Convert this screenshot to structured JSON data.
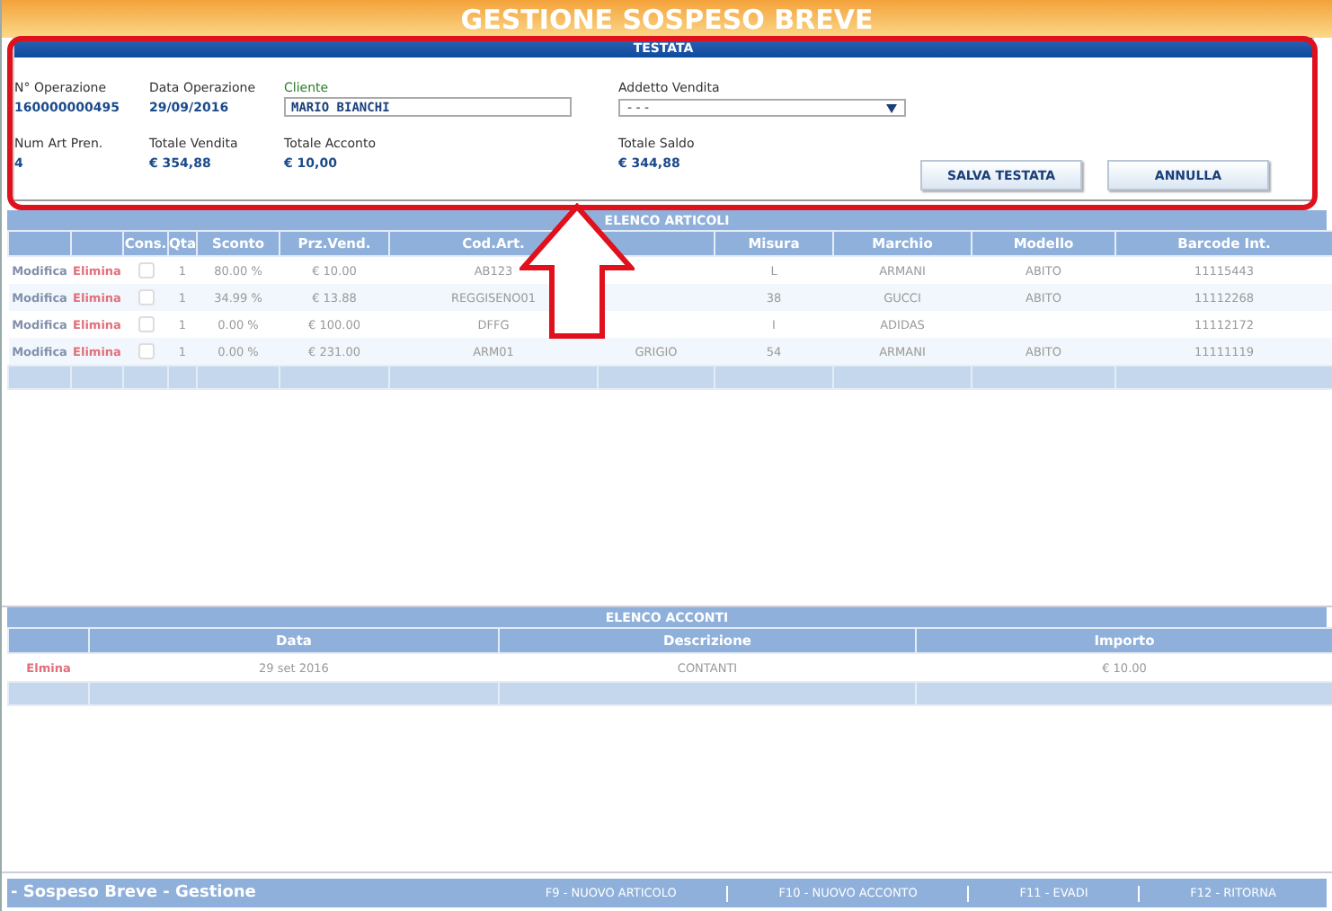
{
  "window": {
    "title": "GESTIONE SOSPESO BREVE"
  },
  "testata": {
    "title": "TESTATA",
    "fields": [
      {
        "label": "N° Operazione",
        "value": "160000000495"
      },
      {
        "label": "Data Operazione",
        "value": "29/09/2016"
      },
      {
        "label": "Num Art Pren.",
        "value": "4"
      },
      {
        "label": "Totale Vendita",
        "value": "€ 354,88"
      },
      {
        "label": "Totale Acconto",
        "value": "€ 10,00"
      },
      {
        "label": "Totale Saldo",
        "value": "€ 344,88"
      }
    ],
    "cliente": {
      "label": "Cliente",
      "value": "MARIO BIANCHI"
    },
    "addetto": {
      "label": "Addetto Vendita",
      "value": "- - -"
    },
    "buttons": [
      "SALVA TESTATA",
      "ANNULLA"
    ]
  },
  "articoli": {
    "title": "ELENCO ARTICOLI",
    "columns": [
      "",
      "",
      "Cons.",
      "Qta",
      "Sconto",
      "Prz.Vend.",
      "Cod.Art.",
      "",
      "Misura",
      "Marchio",
      "Modello",
      "Barcode Int."
    ],
    "rows": [
      {
        "edit": "Modifica",
        "delete": "Elimina",
        "checked": false,
        "qta": "1",
        "sconto": "80.00 %",
        "prezzo": "€ 10.00",
        "codice": "AB123",
        "column_8": "",
        "misura": "L",
        "marchio": "ARMANI",
        "modello": "ABITO",
        "barcode": "11115443"
      },
      {
        "edit": "Modifica",
        "delete": "Elimina",
        "checked": false,
        "qta": "1",
        "sconto": "34.99 %",
        "prezzo": "€ 13.88",
        "codice": "REGGISENO01",
        "column_8": "",
        "misura": "38",
        "marchio": "GUCCI",
        "modello": "ABITO",
        "barcode": "11112268"
      },
      {
        "edit": "Modifica",
        "delete": "Elimina",
        "checked": false,
        "qta": "1",
        "sconto": "0.00 %",
        "prezzo": "€ 100.00",
        "codice": "DFFG",
        "column_8": "",
        "misura": "I",
        "marchio": "ADIDAS",
        "modello": "",
        "barcode": "11112172"
      },
      {
        "edit": "Modifica",
        "delete": "Elimina",
        "checked": false,
        "qta": "1",
        "sconto": "0.00 %",
        "prezzo": "€ 231.00",
        "codice": "ARM01",
        "column_8": "GRIGIO",
        "misura": "54",
        "marchio": "ARMANI",
        "modello": "ABITO",
        "barcode": "11111119"
      }
    ]
  },
  "acconti": {
    "title": "ELENCO ACCONTI",
    "columns": [
      "",
      "Data",
      "Descrizione",
      "Importo"
    ],
    "rows": [
      {
        "delete": "Elmina",
        "data": "29 set 2016",
        "descrizione": "CONTANTI",
        "importo": "€ 10.00"
      }
    ]
  },
  "status_bar": {
    "title": "- Sospeso Breve - Gestione",
    "shortcuts": [
      "F9 - NUOVO ARTICOLO",
      "F10 - NUOVO ACCONTO",
      "F11 - EVADI",
      "F12 - RITORNA"
    ]
  }
}
